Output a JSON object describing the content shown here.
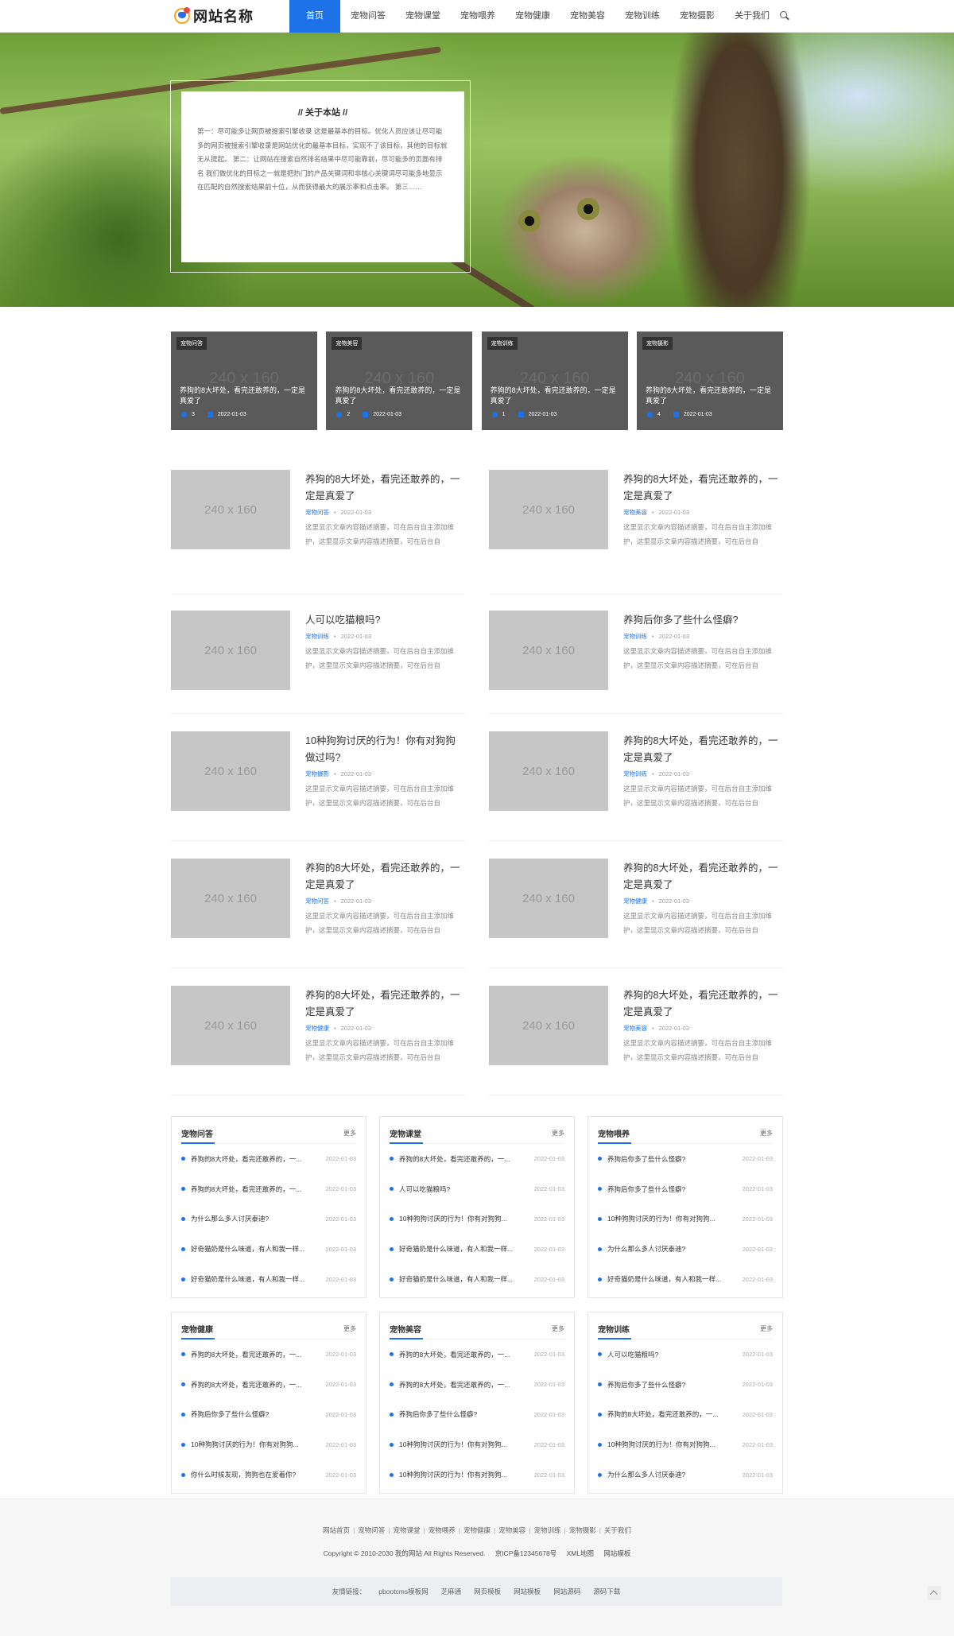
{
  "header": {
    "logo_text": "网站名称",
    "nav": [
      "首页",
      "宠物问答",
      "宠物课堂",
      "宠物喂养",
      "宠物健康",
      "宠物美容",
      "宠物训练",
      "宠物摄影",
      "关于我们"
    ],
    "active_nav": "首页"
  },
  "about": {
    "title": "// 关于本站 //",
    "text": "第一：尽可能多让网页被搜索引擎收录 这是最基本的目标。优化人员应该让尽可能多的网页被搜索引擎收录是网站优化的最基本目标，实现不了该目标，其他的目标就无从提起。 第二：让网站在搜索自然排名结果中尽可能靠前，尽可能多的页面有排名 我们做优化的目标之一就是把热门的产品关键词和非核心关键词尽可能多地显示在匹配的自然搜索结果前十位，从而获得最大的展示率和点击率。 第三……"
  },
  "featured": [
    {
      "tag": "宠物问答",
      "placeholder": "240 x 160",
      "title": "养狗的8大坏处，看完还敢养的，一定是真爱了",
      "count": "3",
      "date": "2022-01-03"
    },
    {
      "tag": "宠物美容",
      "placeholder": "240 x 160",
      "title": "养狗的8大坏处，看完还敢养的，一定是真爱了",
      "count": "2",
      "date": "2022-01-03"
    },
    {
      "tag": "宠物训练",
      "placeholder": "240 x 160",
      "title": "养狗的8大坏处，看完还敢养的，一定是真爱了",
      "count": "1",
      "date": "2022-01-03"
    },
    {
      "tag": "宠物摄影",
      "placeholder": "240 x 160",
      "title": "养狗的8大坏处，看完还敢养的，一定是真爱了",
      "count": "4",
      "date": "2022-01-03"
    }
  ],
  "articles": [
    {
      "thumb": "240 x 160",
      "title": "养狗的8大坏处，看完还敢养的，一定是真爱了",
      "cat": "宠物问答",
      "date": "2022-01-03",
      "desc": "这里显示文章内容描述摘要，可在后台自主添加维护，这里显示文章内容描述摘要，可在后台自"
    },
    {
      "thumb": "240 x 160",
      "title": "养狗的8大坏处，看完还敢养的，一定是真爱了",
      "cat": "宠物美容",
      "date": "2022-01-03",
      "desc": "这里显示文章内容描述摘要，可在后台自主添加维护，这里显示文章内容描述摘要，可在后台自"
    },
    {
      "thumb": "240 x 160",
      "title": "人可以吃猫粮吗?",
      "cat": "宠物训练",
      "date": "2022-01-03",
      "desc": "这里显示文章内容描述摘要，可在后台自主添加维护，这里显示文章内容描述摘要，可在后台自"
    },
    {
      "thumb": "240 x 160",
      "title": "养狗后你多了些什么怪癖?",
      "cat": "宠物训练",
      "date": "2022-01-03",
      "desc": "这里显示文章内容描述摘要，可在后台自主添加维护，这里显示文章内容描述摘要，可在后台自"
    },
    {
      "thumb": "240 x 160",
      "title": "10种狗狗讨厌的行为！你有对狗狗做过吗?",
      "cat": "宠物摄影",
      "date": "2022-01-03",
      "desc": "这里显示文章内容描述摘要，可在后台自主添加维护，这里显示文章内容描述摘要，可在后台自"
    },
    {
      "thumb": "240 x 160",
      "title": "养狗的8大坏处，看完还敢养的，一定是真爱了",
      "cat": "宠物训练",
      "date": "2022-01-03",
      "desc": "这里显示文章内容描述摘要，可在后台自主添加维护，这里显示文章内容描述摘要，可在后台自"
    },
    {
      "thumb": "240 x 160",
      "title": "养狗的8大坏处，看完还敢养的，一定是真爱了",
      "cat": "宠物问答",
      "date": "2022-01-03",
      "desc": "这里显示文章内容描述摘要，可在后台自主添加维护，这里显示文章内容描述摘要，可在后台自"
    },
    {
      "thumb": "240 x 160",
      "title": "养狗的8大坏处，看完还敢养的，一定是真爱了",
      "cat": "宠物健康",
      "date": "2022-01-03",
      "desc": "这里显示文章内容描述摘要，可在后台自主添加维护，这里显示文章内容描述摘要，可在后台自"
    },
    {
      "thumb": "240 x 160",
      "title": "养狗的8大坏处，看完还敢养的，一定是真爱了",
      "cat": "宠物健康",
      "date": "2022-01-03",
      "desc": "这里显示文章内容描述摘要，可在后台自主添加维护，这里显示文章内容描述摘要，可在后台自"
    },
    {
      "thumb": "240 x 160",
      "title": "养狗的8大坏处，看完还敢养的，一定是真爱了",
      "cat": "宠物美容",
      "date": "2022-01-03",
      "desc": "这里显示文章内容描述摘要，可在后台自主添加维护，这里显示文章内容描述摘要，可在后台自"
    }
  ],
  "boxes": [
    {
      "title": "宠物问答",
      "more": "更多",
      "rows": [
        {
          "t": "养狗的8大坏处，看完还敢养的，一...",
          "d": "2022-01-03"
        },
        {
          "t": "养狗的8大坏处，看完还敢养的，一...",
          "d": "2022-01-03"
        },
        {
          "t": "为什么那么多人讨厌泰迪?",
          "d": "2022-01-03"
        },
        {
          "t": "好奇猫奶是什么味道，有人和我一样...",
          "d": "2022-01-03"
        },
        {
          "t": "好奇猫奶是什么味道，有人和我一样...",
          "d": "2022-01-03"
        }
      ]
    },
    {
      "title": "宠物课堂",
      "more": "更多",
      "rows": [
        {
          "t": "养狗的8大坏处，看完还敢养的，一...",
          "d": "2022-01-03"
        },
        {
          "t": "人可以吃猫粮吗?",
          "d": "2022-01-03"
        },
        {
          "t": "10种狗狗讨厌的行为！你有对狗狗...",
          "d": "2022-01-03"
        },
        {
          "t": "好奇猫奶是什么味道，有人和我一样...",
          "d": "2022-01-03"
        },
        {
          "t": "好奇猫奶是什么味道，有人和我一样...",
          "d": "2022-01-03"
        }
      ]
    },
    {
      "title": "宠物喂养",
      "more": "更多",
      "rows": [
        {
          "t": "养狗后你多了些什么怪癖?",
          "d": "2022-01-03"
        },
        {
          "t": "养狗后你多了些什么怪癖?",
          "d": "2022-01-03"
        },
        {
          "t": "10种狗狗讨厌的行为！你有对狗狗...",
          "d": "2022-01-03"
        },
        {
          "t": "为什么那么多人讨厌泰迪?",
          "d": "2022-01-03"
        },
        {
          "t": "好奇猫奶是什么味道，有人和我一样...",
          "d": "2022-01-03"
        }
      ]
    },
    {
      "title": "宠物健康",
      "more": "更多",
      "rows": [
        {
          "t": "养狗的8大坏处，看完还敢养的，一...",
          "d": "2022-01-03"
        },
        {
          "t": "养狗的8大坏处，看完还敢养的，一...",
          "d": "2022-01-03"
        },
        {
          "t": "养狗后你多了些什么怪癖?",
          "d": "2022-01-03"
        },
        {
          "t": "10种狗狗讨厌的行为！你有对狗狗...",
          "d": "2022-01-03"
        },
        {
          "t": "你什么时候发现，狗狗也在爱着你?",
          "d": "2022-01-03"
        }
      ]
    },
    {
      "title": "宠物美容",
      "more": "更多",
      "rows": [
        {
          "t": "养狗的8大坏处，看完还敢养的，一...",
          "d": "2022-01-03"
        },
        {
          "t": "养狗的8大坏处，看完还敢养的，一...",
          "d": "2022-01-03"
        },
        {
          "t": "养狗后你多了些什么怪癖?",
          "d": "2022-01-03"
        },
        {
          "t": "10种狗狗讨厌的行为！你有对狗狗...",
          "d": "2022-01-03"
        },
        {
          "t": "10种狗狗讨厌的行为！你有对狗狗...",
          "d": "2022-01-03"
        }
      ]
    },
    {
      "title": "宠物训练",
      "more": "更多",
      "rows": [
        {
          "t": "人可以吃猫粮吗?",
          "d": "2022-01-03"
        },
        {
          "t": "养狗后你多了些什么怪癖?",
          "d": "2022-01-03"
        },
        {
          "t": "养狗的8大坏处，看完还敢养的，一...",
          "d": "2022-01-03"
        },
        {
          "t": "10种狗狗讨厌的行为！你有对狗狗...",
          "d": "2022-01-03"
        },
        {
          "t": "为什么那么多人讨厌泰迪?",
          "d": "2022-01-03"
        }
      ]
    }
  ],
  "footer": {
    "links": [
      "网站首页",
      "宠物问答",
      "宠物课堂",
      "宠物喂养",
      "宠物健康",
      "宠物美容",
      "宠物训练",
      "宠物摄影",
      "关于我们"
    ],
    "copyright": "Copyright © 2010-2030 我的网站 All Rights Reserved.",
    "icp": "京ICP备12345678号",
    "xml": "XML地图",
    "template": "网站模板",
    "friends_label": "友情链接：",
    "friends": [
      "pbootcms模板网",
      "芝麻通",
      "网页模板",
      "网站模板",
      "网站源码",
      "源码下载"
    ]
  }
}
